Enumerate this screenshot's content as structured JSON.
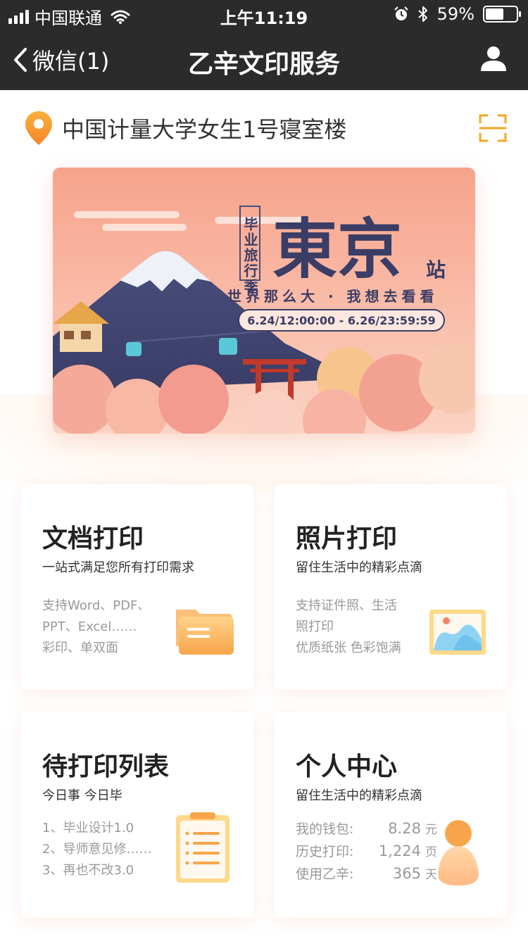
{
  "status_bar": {
    "carrier": "中国联通",
    "time": "上午11:19",
    "battery": "59%",
    "battery_level": 0.59
  },
  "nav": {
    "back_label": "微信(1)",
    "title": "乙辛文印服务"
  },
  "location": {
    "text": "中国计量大学女生1号寝室楼"
  },
  "banner": {
    "tag": "毕业旅行季",
    "headline": "東京",
    "headline_suffix": "站",
    "slogan": "世界那么大 · 我想去看看",
    "date_range": "6.24/12:00:00 - 6.26/23:59:59"
  },
  "cards": {
    "doc": {
      "title": "文档打印",
      "subtitle": "一站式满足您所有打印需求",
      "lines": [
        "支持Word、PDF、",
        "PPT、Excel……",
        "彩印、单双面"
      ]
    },
    "photo": {
      "title": "照片打印",
      "subtitle": "留住生活中的精彩点滴",
      "lines": [
        "支持证件照、生活",
        "照打印",
        "优质纸张  色彩饱满"
      ]
    },
    "queue": {
      "title": "待打印列表",
      "subtitle": "今日事  今日毕",
      "lines": [
        "1、毕业设计1.0",
        "2、导师意见修……",
        "3、再也不改3.0"
      ]
    },
    "profile": {
      "title": "个人中心",
      "subtitle": "留住生活中的精彩点滴",
      "stats": [
        {
          "label": "我的钱包:",
          "value": "8.28",
          "unit": "元"
        },
        {
          "label": "历史打印:",
          "value": "1,224",
          "unit": "页"
        },
        {
          "label": "使用乙辛:",
          "value": "365",
          "unit": "天"
        }
      ]
    }
  },
  "colors": {
    "nav_bg": "#2b2b2b",
    "accent_orange": "#f5a623",
    "banner_peach": "#f7a38b",
    "text_dark": "#222222",
    "text_muted": "#999999"
  },
  "icons": [
    "chevron-left-icon",
    "user-icon",
    "location-pin-icon",
    "scan-icon",
    "folder-icon",
    "image-icon",
    "clipboard-icon",
    "person-icon"
  ]
}
